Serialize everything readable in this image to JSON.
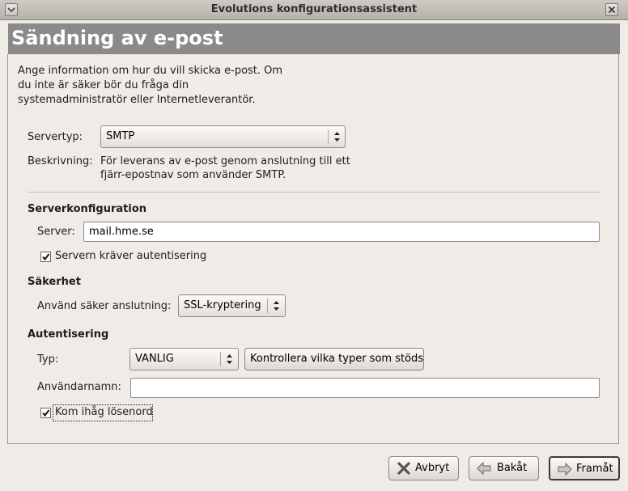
{
  "window": {
    "title": "Evolutions konfigurationsassistent"
  },
  "page": {
    "title": "Sändning av e-post",
    "intro": [
      "Ange information om hur du vill skicka e-post. Om",
      "du inte är säker bör du fråga din",
      "systemadministratör eller Internetleverantör."
    ]
  },
  "server_type": {
    "label": "Servertyp:",
    "value": "SMTP",
    "desc_label": "Beskrivning:",
    "desc": [
      "För leverans av e-post genom anslutning till ett",
      "fjärr-epostnav som använder SMTP."
    ]
  },
  "server_config": {
    "heading": "Serverkonfiguration",
    "server_label": "Server:",
    "server_value": "mail.hme.se",
    "auth_required_label": "Servern kräver autentisering",
    "auth_required_checked": true
  },
  "security": {
    "heading": "Säkerhet",
    "secure_label": "Använd säker anslutning:",
    "secure_value": "SSL-kryptering"
  },
  "auth": {
    "heading": "Autentisering",
    "type_label": "Typ:",
    "type_value": "VANLIG",
    "check_types_button": "Kontrollera vilka typer som stöds",
    "username_label": "Användarnamn:",
    "username_value": "",
    "remember_label": "Kom ihåg lösenord",
    "remember_checked": true
  },
  "buttons": {
    "cancel": "Avbryt",
    "back": "Bakåt",
    "forward": "Framåt"
  }
}
